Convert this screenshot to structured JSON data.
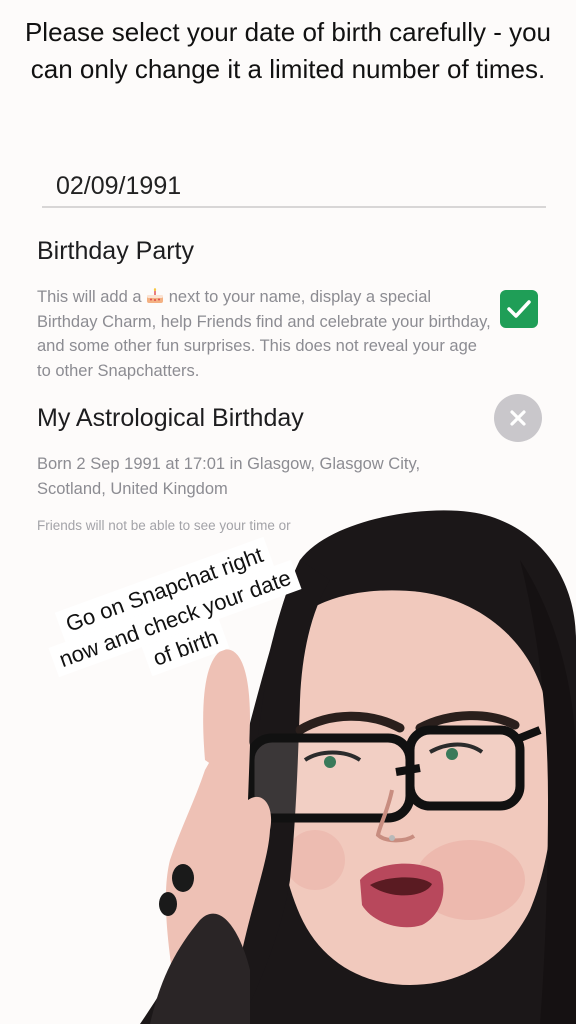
{
  "notice": "Please select your date of birth carefully - you can only change it a limited number of times.",
  "dob": {
    "value": "02/09/1991"
  },
  "birthday_party": {
    "title": "Birthday Party",
    "desc_before_icon": "This will add a",
    "desc_after_icon": "next to your name, display a special Birthday Charm, help Friends find and celebrate your birthday, and some other fun surprises. This does not reveal your age to other Snapchatters.",
    "icon": "birthday-cake-emoji",
    "checked": true,
    "check_color": "#1f9e57"
  },
  "astro": {
    "title": "My Astrological Birthday",
    "desc": "Born 2 Sep 1991 at 17:01 in Glasgow, Glasgow City, Scotland, United Kingdom",
    "footnote": "Friends will not be able to see your time or"
  },
  "caption": {
    "line1": "Go on Snapchat right",
    "line2": "now and check your date",
    "line3": "of birth"
  }
}
